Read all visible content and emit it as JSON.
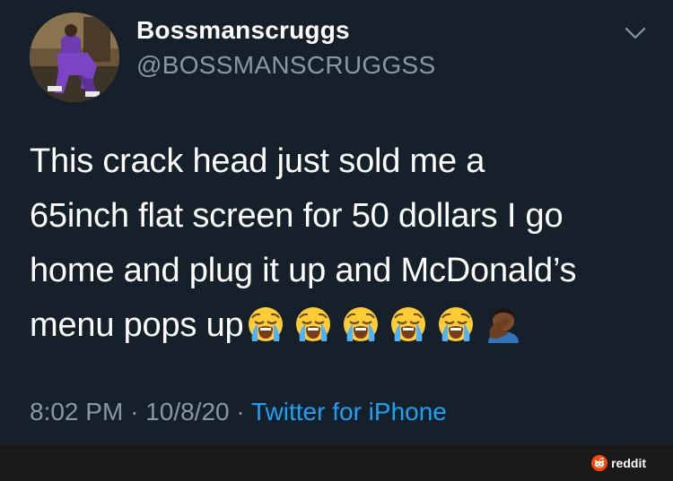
{
  "tweet": {
    "display_name": "Bossmanscruggs",
    "handle": "@BOSSMANSCRUGGSS",
    "text_lines": [
      "This crack head just sold me a",
      "65inch flat screen for 50 dollars I go",
      "home and plug it up and McDonald’s",
      "menu pops up"
    ],
    "emojis": [
      "loudly-crying-face",
      "loudly-crying-face",
      "loudly-crying-face",
      "loudly-crying-face",
      "loudly-crying-face",
      "man-facepalming-dark-skin-tone"
    ],
    "time": "8:02 PM",
    "separator": "·",
    "date": "10/8/20",
    "source": "Twitter for iPhone"
  },
  "footer": {
    "brand_label": "reddit"
  },
  "colors": {
    "background": "#15202b",
    "text": "#ffffff",
    "secondary": "#8899a6",
    "link": "#1da1f2",
    "footer": "#1a1a1b",
    "reddit_orange": "#ff4500"
  },
  "icons": {
    "menu": "chevron-down-icon",
    "brand": "reddit-logo-icon"
  }
}
